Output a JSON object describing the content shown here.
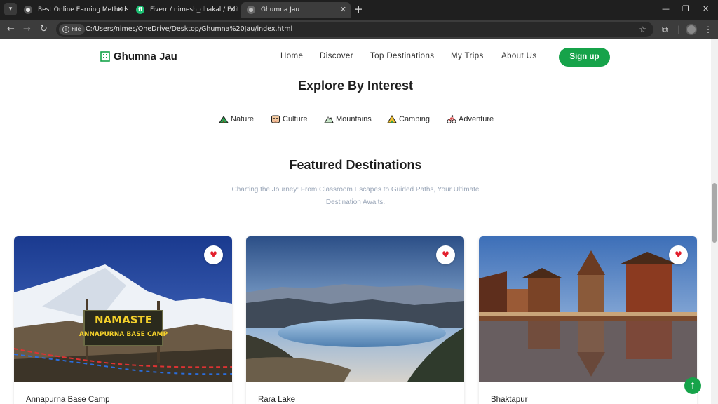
{
  "browser": {
    "tabs": [
      {
        "title": "Best Online Earning Methods",
        "active": false
      },
      {
        "title": "Fiverr / nimesh_dhakal / Edit Gi",
        "active": false
      },
      {
        "title": "Ghumna Jau",
        "active": true
      }
    ],
    "address_chip": "File",
    "url": "C:/Users/nimes/OneDrive/Desktop/Ghumna%20Jau/index.html"
  },
  "header": {
    "brand": "Ghumna Jau",
    "nav": [
      "Home",
      "Discover",
      "Top Destinations",
      "My Trips",
      "About Us"
    ],
    "signup_label": "Sign up"
  },
  "explore": {
    "title": "Explore By Interest",
    "interests": [
      {
        "label": "Nature",
        "icon": "nature-icon"
      },
      {
        "label": "Culture",
        "icon": "culture-icon"
      },
      {
        "label": "Mountains",
        "icon": "mountains-icon"
      },
      {
        "label": "Camping",
        "icon": "camping-icon"
      },
      {
        "label": "Adventure",
        "icon": "adventure-icon"
      }
    ]
  },
  "featured": {
    "title": "Featured Destinations",
    "subtitle": "Charting the Journey: From Classroom Escapes to Guided Paths, Your Ultimate Destination Awaits.",
    "cards": [
      {
        "name": "Annapurna Base Camp",
        "sign_line1": "NAMASTE",
        "sign_line2": "ANNAPURNA BASE CAMP"
      },
      {
        "name": "Rara Lake"
      },
      {
        "name": "Bhaktapur"
      }
    ]
  },
  "colors": {
    "accent": "#16a34a",
    "heart": "#e3202d",
    "subtitle": "#9aa6b8"
  }
}
